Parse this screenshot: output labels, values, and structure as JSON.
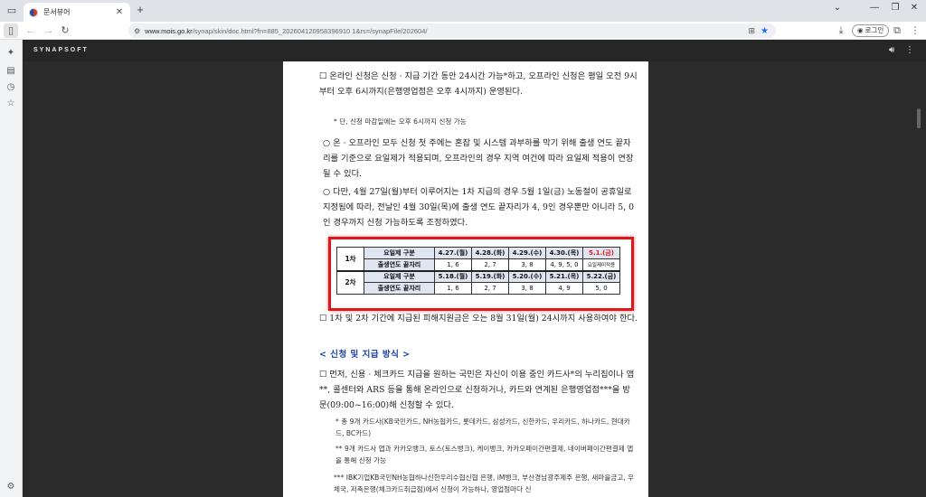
{
  "browser": {
    "tab_title": "문서뷰어",
    "url_host": "www.mois.go.kr",
    "url_path": "/synap/skin/doc.html?fn=885_202604120958396910 1&rs=/synapFile/202604/",
    "login_label": "로그인"
  },
  "viewer": {
    "brand": "SYNAPSOFT"
  },
  "document": {
    "para1": "☐ 온라인 신청은 신청 · 지급 기간 동안 24시간 가능*하고, 오프라인 신청은 평일 오전 9시부터 오후 6시까지(은행영업점은 오후 4시까지) 운영된다.",
    "note1": "* 단, 신청 마감일에는 오후 6시까지 신청 가능",
    "para2": "○ 온 · 오프라인 모두 신청 첫 주에는 혼잡 및 시스템 과부하를 막기 위해 출생 연도 끝자리를 기준으로 요일제가 적용되며, 오프라인의 경우 지역 여건에 따라 요일제 적용이 연장될 수 있다.",
    "para3": "○ 다만, 4월 27일(월)부터 이루어지는 1차 지급의 경우 5월 1일(금) 노동절이 공휴일로 지정됨에 따라, 전날인 4월 30일(목)에 출생 연도 끝자리가 4, 9인 경우뿐만 아니라 5, 0인 경우까지 신청 가능하도록 조정하였다.",
    "para4": "☐ 1차 및 2차 기간에 지급된 피해지원금은 오는 8월 31일(월) 24시까지 사용하여야 한다.",
    "heading1": "< 신청 및 지급 방식 >",
    "para5": "☐ 먼저, 신용 · 체크카드 지급을 원하는 국민은 자신이 이용 중인 카드사*의 누리집이나 앱**, 콜센터와 ARS 등을 통해 온라인으로 신청하거나, 카드와 연계된 은행영업점***을 방문(09:00~16:00)해 신청할 수 있다.",
    "note2": "* 총 9개 카드사(KB국민카드, NH농협카드, 롯데카드, 삼성카드, 신한카드, 우리카드, 하나카드, 현대카드, BC카드)",
    "note3": "** 9개 카드사 앱과 카카오뱅크, 토스(토스뱅크), 케이뱅크, 카카오페이간편결제, 네이버페이간편결제 앱을 통해 신청 가능",
    "note4": "*** IBK기업KB국민NH농협하나신한우리수협신협 은행, iM뱅크, 부산경남광주제주 은행, 새마을금고, 우체국, 저축은행(체크카드취급점)에서 신청이 가능하나, 영업점마다 신"
  },
  "schedule": {
    "round1": {
      "round_label": "1차",
      "day_label": "요일제 구분",
      "days": [
        "4.27.(월)",
        "4.28.(화)",
        "4.29.(수)",
        "4.30.(목)",
        "5.1.(금)"
      ],
      "digit_label": "출생연도 끝자리",
      "digits": [
        "1, 6",
        "2, 7",
        "3, 8",
        "4, 9, 5, 0",
        "요일제미적용"
      ]
    },
    "round2": {
      "round_label": "2차",
      "day_label": "요일제 구분",
      "days": [
        "5.18.(월)",
        "5.19.(화)",
        "5.20.(수)",
        "5.21.(목)",
        "5.22.(금)"
      ],
      "digit_label": "출생연도 끝자리",
      "digits": [
        "1, 6",
        "2, 7",
        "3, 8",
        "4, 9",
        "5, 0"
      ]
    }
  },
  "colors": {
    "highlight_border": "#e0161b",
    "holiday_text": "#e0161b",
    "table_header_bg": "#dfe6f2",
    "heading_blue": "#1a3fa0"
  }
}
